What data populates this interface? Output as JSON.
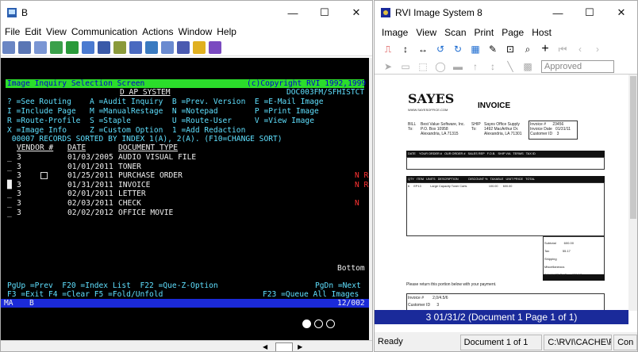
{
  "left_window": {
    "title": "B",
    "menu": [
      "File",
      "Edit",
      "View",
      "Communication",
      "Actions",
      "Window",
      "Help"
    ],
    "controls": {
      "minimize": "—",
      "maximize": "☐",
      "close": "✕"
    }
  },
  "terminal": {
    "header_left": "Image Inquiry Selection Screen",
    "header_right": "(c)Copyright RVI 1992,1999",
    "system": "D AP SYSTEM",
    "program": "DOC003FM/SFHISTCT",
    "options_lines": [
      "? =See Routing    A =Audit Inquiry  B =Prev. Version  E =E-Mail Image",
      "I =Include Page   M =ManualRestage  N =Notepad        P =Print Image",
      "R =Route-Profile  S =Staple         U =Route-User     V =View Image",
      "X =Image Info     Z =Custom Option  1 =Add Redaction"
    ],
    "records_line": " 00007 RECORDS SORTED BY INDEX 1(A), 2(A). (F10=CHANGE SORT)",
    "columns": {
      "vendor": "VENDOR #",
      "date": "DATE",
      "doc_type": "DOCUMENT TYPE"
    },
    "rows": [
      {
        "sel": "_",
        "vendor": "3",
        "date": "01/03/2005",
        "doc": "AUDIO VISUAL FILE",
        "flags": ""
      },
      {
        "sel": "_",
        "vendor": "3",
        "date": "01/01/2011",
        "doc": "TONER",
        "flags": ""
      },
      {
        "sel": "_",
        "vendor": "3",
        "date": "01/25/2011",
        "doc": "PURCHASE ORDER",
        "flags": "N R"
      },
      {
        "sel": "█",
        "vendor": "3",
        "date": "01/31/2011",
        "doc": "INVOICE",
        "flags": "N R"
      },
      {
        "sel": "_",
        "vendor": "3",
        "date": "02/01/2011",
        "doc": "LETTER",
        "flags": ""
      },
      {
        "sel": "_",
        "vendor": "3",
        "date": "02/03/2011",
        "doc": "CHECK",
        "flags": "N"
      },
      {
        "sel": "_",
        "vendor": "3",
        "date": "02/02/2012",
        "doc": "OFFICE MOVIE",
        "flags": ""
      }
    ],
    "bottom_label": "Bottom",
    "fkeys_line1_left": "PgUp =Prev  F20 =Index List  F22 =Que-Z-Option",
    "fkeys_line1_right": "PgDn =Next",
    "fkeys_line2_left": "F3 =Exit F4 =Clear F5 =Fold/Unfold",
    "fkeys_line2_right": "F23 =Queue All Images",
    "status_left": "MA",
    "status_session": "B",
    "status_right": "12/002"
  },
  "right_window": {
    "title": "RVI Image System 8",
    "menu": [
      "Image",
      "View",
      "Scan",
      "Print",
      "Page",
      "Host"
    ],
    "approved_placeholder": "Approved",
    "page_status": "3 01/31/2 (Document 1 Page 1 of 1)",
    "status_ready": "Ready",
    "status_doc": "Document 1 of 1",
    "status_path": "C:\\RVI\\CACHE\\PD",
    "status_con": "Con",
    "invoice": {
      "logo": "SAYES",
      "logo_sub": "WWW.SAYESOFFICE.COM",
      "title": "INVOICE",
      "bill_label": "BILL\nTo:",
      "bill_to": "Best Value Software, Inc.\nP.O. Box 10958\nAlexandria, LA 71315",
      "ship_label": "SHIP\nTo:",
      "ship_to": "Sayes Office Supply\n1492 MacArthur Dr.\nAlexandria, LA 71301",
      "meta": "Invoice #      23456\nInvoice Date   01/31/11\nCustomer ID    3",
      "order_headers": "DATE    YOUR ORDER #   OUR ORDER #   SALES REP   F.O.B.   SHIP VIA   TERMS   TAX ID",
      "item_headers": "QTY   ITEM   UNITS   DESCRIPTION            DISCOUNT %   TAXABLE   UNIT PRICE   TOTAL",
      "item_line": "6     EP13           Large Capacity Toner Carts                          100.00      600.00",
      "totals": "Subtotal         600.00\nTax               55.17\nShipping\nMiscellaneous\nBALANCE DUE      655.17",
      "footer": "Please return this portion below with your payment.",
      "footer_fields": "Invoice #        2,0/4.5/6\nCustomer ID      3"
    }
  }
}
